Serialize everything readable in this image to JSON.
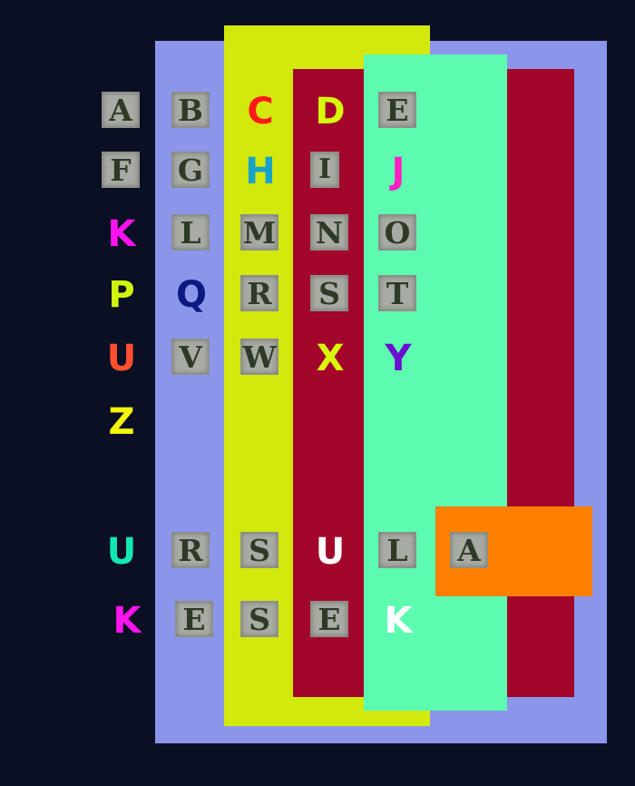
{
  "rows": [
    [
      {
        "char": "A",
        "style": "stencil",
        "color": ""
      },
      {
        "char": "B",
        "style": "stencil",
        "color": ""
      },
      {
        "char": "C",
        "style": "color",
        "color": "#ff1a1a"
      },
      {
        "char": "D",
        "style": "color",
        "color": "#d7f70c"
      },
      {
        "char": "E",
        "style": "stencil",
        "color": ""
      }
    ],
    [
      {
        "char": "F",
        "style": "stencil",
        "color": ""
      },
      {
        "char": "G",
        "style": "stencil",
        "color": ""
      },
      {
        "char": "H",
        "style": "color",
        "color": "#17a3c8"
      },
      {
        "char": "I",
        "style": "stencil",
        "color": ""
      },
      {
        "char": "J",
        "style": "color",
        "color": "#ff1fc0"
      }
    ],
    [
      {
        "char": "K",
        "style": "color",
        "color": "#ff14f0"
      },
      {
        "char": "L",
        "style": "stencil",
        "color": ""
      },
      {
        "char": "M",
        "style": "stencil",
        "color": ""
      },
      {
        "char": "N",
        "style": "stencil",
        "color": ""
      },
      {
        "char": "O",
        "style": "stencil",
        "color": ""
      }
    ],
    [
      {
        "char": "P",
        "style": "color",
        "color": "#d0f50d"
      },
      {
        "char": "Q",
        "style": "color",
        "color": "#0a1a80"
      },
      {
        "char": "R",
        "style": "stencil",
        "color": ""
      },
      {
        "char": "S",
        "style": "stencil",
        "color": ""
      },
      {
        "char": "T",
        "style": "stencil",
        "color": ""
      }
    ],
    [
      {
        "char": "U",
        "style": "color",
        "color": "#ff4f2e"
      },
      {
        "char": "V",
        "style": "stencil",
        "color": ""
      },
      {
        "char": "W",
        "style": "stencil",
        "color": ""
      },
      {
        "char": "X",
        "style": "color",
        "color": "#d7f70c"
      },
      {
        "char": "Y",
        "style": "color",
        "color": "#6a0fd0"
      }
    ],
    [
      {
        "char": "Z",
        "style": "color",
        "color": "#f6f60a"
      }
    ],
    [
      {
        "char": "U",
        "style": "color",
        "color": "#14e8b2"
      },
      {
        "char": "R",
        "style": "stencil",
        "color": ""
      },
      {
        "char": "S",
        "style": "stencil",
        "color": ""
      },
      {
        "char": "U",
        "style": "color",
        "color": "#ffffff"
      },
      {
        "char": "L",
        "style": "stencil",
        "color": ""
      },
      {
        "char": "A",
        "style": "stencil",
        "color": ""
      }
    ],
    [
      {
        "char": "K",
        "style": "color",
        "color": "#ff14f0"
      },
      {
        "char": "E",
        "style": "stencil",
        "color": ""
      },
      {
        "char": "S",
        "style": "stencil",
        "color": ""
      },
      {
        "char": "E",
        "style": "stencil",
        "color": ""
      },
      {
        "char": "K",
        "style": "color",
        "color": "#ffffff"
      }
    ]
  ]
}
